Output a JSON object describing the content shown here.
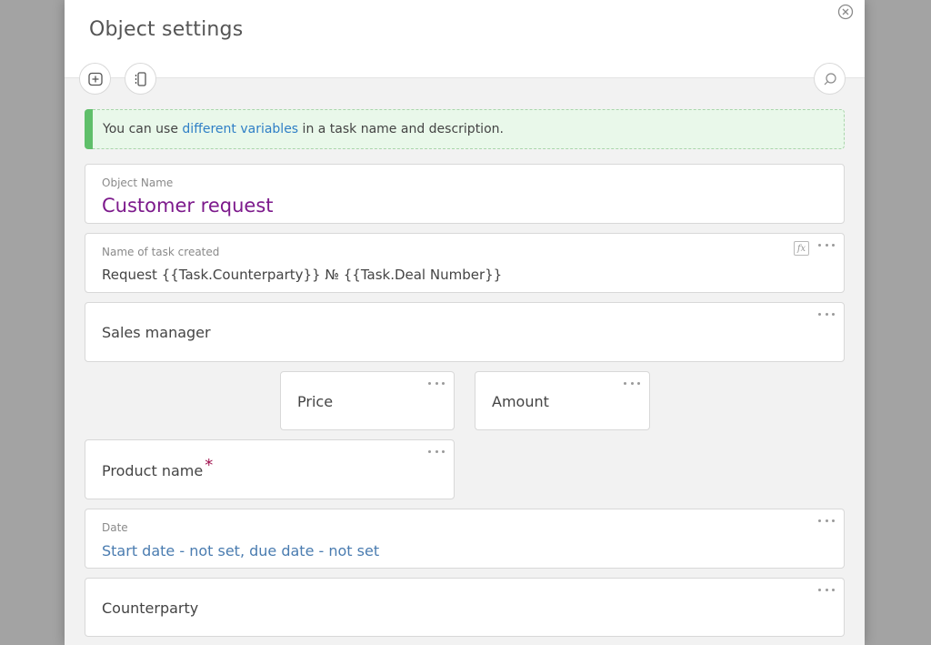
{
  "modal": {
    "title": "Object settings"
  },
  "notice": {
    "text_before": "You can use ",
    "link": "different variables",
    "text_after": " in a task name and description."
  },
  "fields": {
    "object_name": {
      "label": "Object Name",
      "value": "Customer request"
    },
    "task_name": {
      "label": "Name of task created",
      "value": "Request {{Task.Counterparty}} № {{Task.Deal Number}}",
      "fx_label": "fx"
    },
    "sales_manager": {
      "value": "Sales manager"
    },
    "price": {
      "value": "Price"
    },
    "amount": {
      "value": "Amount"
    },
    "product_name": {
      "value": "Product name",
      "required_mark": "*"
    },
    "date": {
      "label": "Date",
      "value": "Start date - not set, due date - not set"
    },
    "counterparty": {
      "value": "Counterparty"
    }
  },
  "colors": {
    "accent_purple": "#7d1a8c",
    "link_blue": "#2f7fc6",
    "date_blue": "#4a7cb0",
    "notice_green": "#5fbf6a",
    "required_red": "#a0134f"
  }
}
